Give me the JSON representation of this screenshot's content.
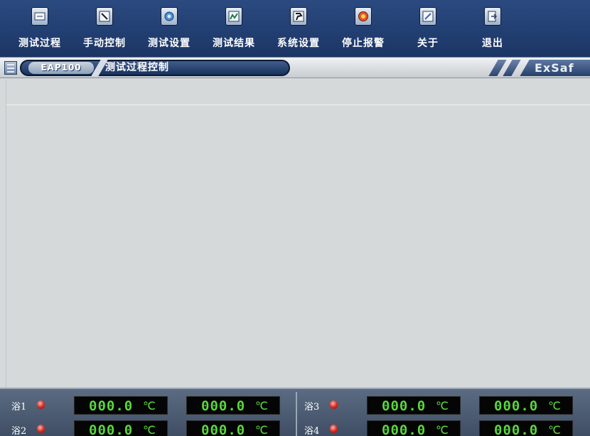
{
  "toolbar": {
    "items": [
      {
        "label": "测试过程",
        "icon": "process-icon"
      },
      {
        "label": "手动控制",
        "icon": "manual-control-icon"
      },
      {
        "label": "测试设置",
        "icon": "test-settings-icon"
      },
      {
        "label": "测试结果",
        "icon": "results-icon"
      },
      {
        "label": "系统设置",
        "icon": "system-settings-icon"
      },
      {
        "label": "停止报警",
        "icon": "stop-alarm-icon"
      },
      {
        "label": "关于",
        "icon": "about-icon"
      },
      {
        "label": "退出",
        "icon": "exit-icon"
      }
    ]
  },
  "tabbar": {
    "model": "EAP100",
    "title": "测试过程控制",
    "brand": "ExSaf"
  },
  "temps": {
    "baths": [
      {
        "label": "浴1",
        "value1": "000.0",
        "unit1": "℃",
        "value2": "000.0",
        "unit2": "℃"
      },
      {
        "label": "浴2",
        "value1": "000.0",
        "unit1": "℃",
        "value2": "000.0",
        "unit2": "℃"
      },
      {
        "label": "浴3",
        "value1": "000.0",
        "unit1": "℃",
        "value2": "000.0",
        "unit2": "℃"
      },
      {
        "label": "浴4",
        "value1": "000.0",
        "unit1": "℃",
        "value2": "000.0",
        "unit2": "℃"
      }
    ]
  },
  "colors": {
    "toolbar_bg": "#223f72",
    "lcd_digits": "#58d83c",
    "lcd_bg": "#050505",
    "main_bg": "#d5d9da"
  }
}
